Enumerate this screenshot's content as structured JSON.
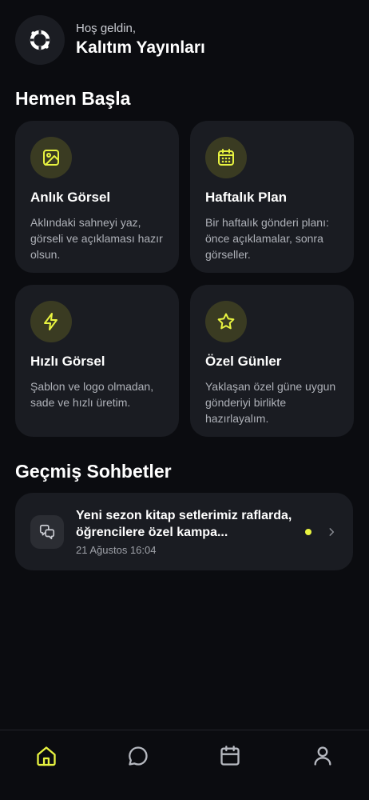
{
  "header": {
    "greeting": "Hoş geldin,",
    "brand": "Kalıtım Yayınları",
    "logo_icon": "ring-logo-icon"
  },
  "quick_start": {
    "title": "Hemen Başla",
    "cards": [
      {
        "icon": "image-icon",
        "title": "Anlık Görsel",
        "description": "Aklındaki sahneyi yaz, görseli ve açıklaması hazır olsun."
      },
      {
        "icon": "calendar-grid-icon",
        "title": "Haftalık Plan",
        "description": "Bir haftalık gönderi planı: önce açıklamalar, sonra görseller."
      },
      {
        "icon": "lightning-icon",
        "title": "Hızlı Görsel",
        "description": "Şablon ve logo olmadan, sade ve hızlı üretim."
      },
      {
        "icon": "star-icon",
        "title": "Özel Günler",
        "description": "Yaklaşan özel güne uygun gönderiyi birlikte hazırlayalım."
      }
    ]
  },
  "history": {
    "title": "Geçmiş Sohbetler",
    "items": [
      {
        "icon": "chat-bubbles-icon",
        "title": "Yeni sezon kitap setlerimiz raflarda, öğrencilere özel kampa...",
        "date": "21 Ağustos 16:04",
        "unread": true
      }
    ]
  },
  "nav": {
    "items": [
      {
        "icon": "home-icon",
        "active": true
      },
      {
        "icon": "chat-icon",
        "active": false
      },
      {
        "icon": "calendar-icon",
        "active": false
      },
      {
        "icon": "profile-icon",
        "active": false
      }
    ]
  },
  "colors": {
    "background": "#0b0c10",
    "card": "#1a1c22",
    "accent": "#e8f340",
    "icon_bg": "#3a3b22",
    "muted_text": "#aeb1b8"
  }
}
